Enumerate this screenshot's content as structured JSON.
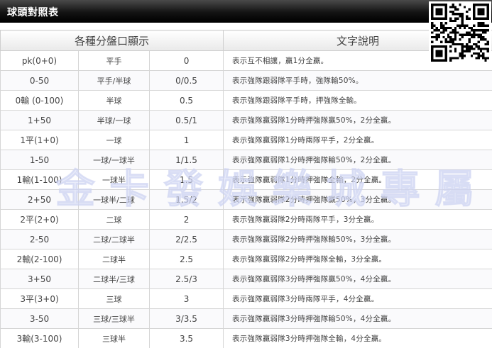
{
  "header": {
    "title": "球頭對照表"
  },
  "qr_code": {
    "icon": "qr-code-icon"
  },
  "table": {
    "headers": [
      "各種分盤口顯示",
      "文字說明"
    ],
    "rows": [
      [
        "pk(0+0)",
        "平手",
        "0",
        "表示互不相讓，贏1分全贏。"
      ],
      [
        "0-50",
        "平手/半球",
        "0/0.5",
        "表示強隊跟弱隊平手時，強隊輸50%。"
      ],
      [
        "0輸 (0-100)",
        "半球",
        "0.5",
        "表示強隊跟弱隊平手時，押強隊全輸。"
      ],
      [
        "1+50",
        "半球/一球",
        "0.5/1",
        "表示強隊贏弱隊1分時押強隊贏50%，2分全贏。"
      ],
      [
        "1平(1+0)",
        "一球",
        "1",
        "表示強隊贏弱隊1分時兩隊平手，2分全贏。"
      ],
      [
        "1-50",
        "一球/一球半",
        "1/1.5",
        "表示強隊贏弱隊1分時押強隊輸50%，2分全贏。"
      ],
      [
        "1輸(1-100)",
        "一球半",
        "1.5",
        "表示強隊贏弱隊1分時押強隊全輸，2分全贏。"
      ],
      [
        "2+50",
        "一球半/二球",
        "1.5/2",
        "表示強隊贏弱隊2分時押強隊贏50%，3分全贏。"
      ],
      [
        "2平(2+0)",
        "二球",
        "2",
        "表示強隊贏弱隊2分時兩隊平手，3分全贏。"
      ],
      [
        "2-50",
        "二球/二球半",
        "2/2.5",
        "表示強隊贏弱隊2分時押強隊輸50%，3分全贏。"
      ],
      [
        "2輸(2-100)",
        "二球半",
        "2.5",
        "表示強隊贏弱隊2分時押強隊全輸，3分全贏。"
      ],
      [
        "3+50",
        "二球半/三球",
        "2.5/3",
        "表示強隊贏弱隊3分時押強隊贏50%，4分全贏。"
      ],
      [
        "3平(3+0)",
        "三球",
        "3",
        "表示強隊贏弱隊3分時兩隊平手，4分全贏。"
      ],
      [
        "3-50",
        "三球/三球半",
        "3/3.5",
        "表示強隊贏弱隊3分時押強隊輸50%，4分全贏。"
      ],
      [
        "3輸(3-100)",
        "三球半",
        "3.5",
        "表示強隊贏弱隊3分時押強隊全輸，4分全贏。"
      ]
    ]
  },
  "watermark": {
    "chars": [
      "金",
      "卡",
      "發",
      "娛",
      "樂",
      "城",
      "專",
      "屬"
    ]
  }
}
